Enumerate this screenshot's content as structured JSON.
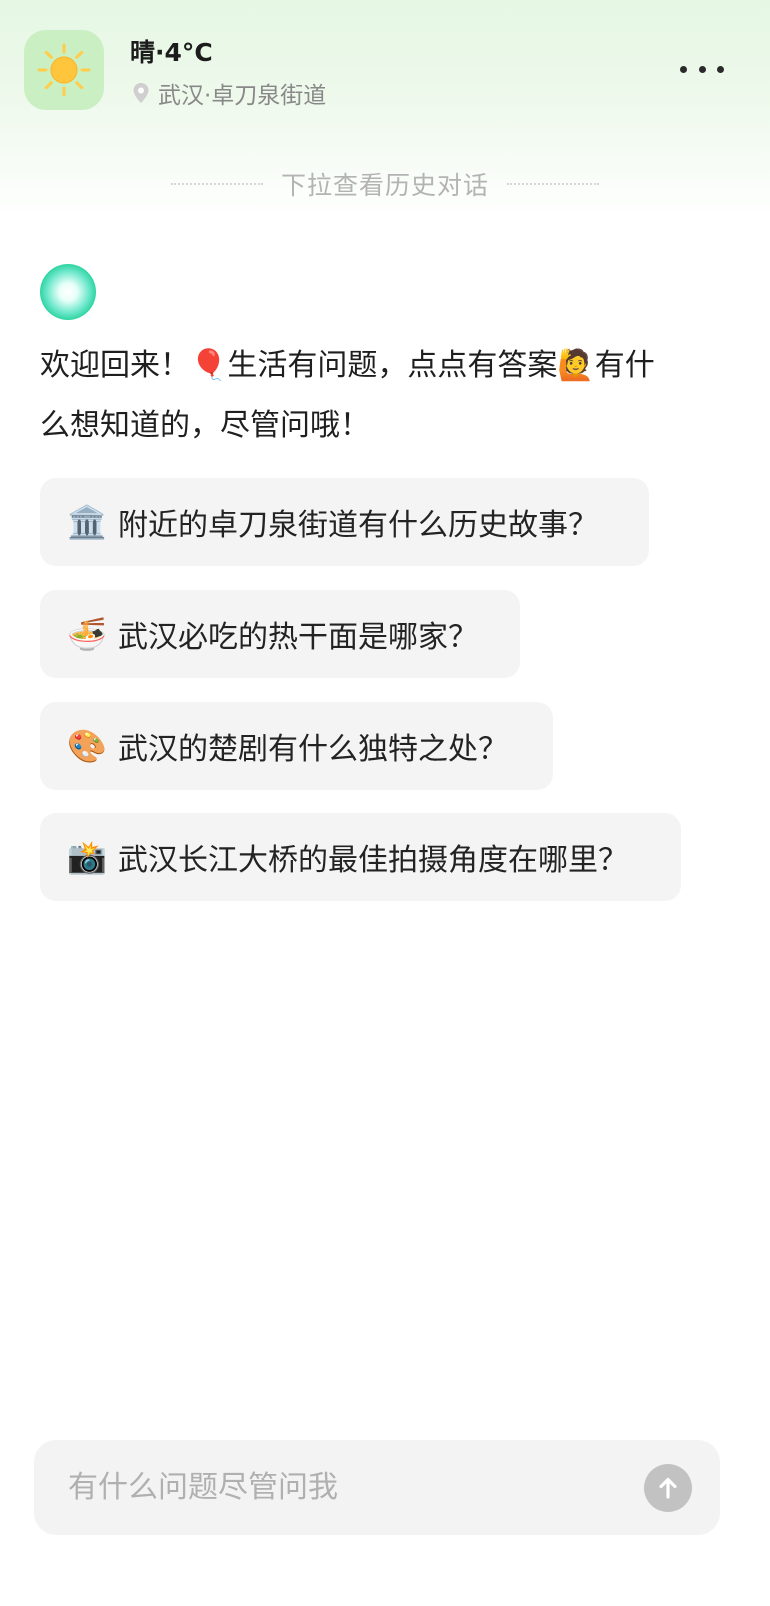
{
  "header": {
    "weather_title": "晴·4°C",
    "location": "武汉·卓刀泉街道",
    "weather_icon": "sun-icon",
    "more_icon": "more-dots-icon"
  },
  "history_hint": "下拉查看历史对话",
  "assistant": {
    "avatar_icon": "assistant-orb-icon",
    "welcome_line1": "欢迎回来！🎈生活有问题，点点有答案🙋有什",
    "welcome_line2": "么想知道的，尽管问哦！"
  },
  "suggestions": [
    {
      "icon": "🏛️",
      "icon_name": "museum-icon",
      "text": "附近的卓刀泉街道有什么历史故事？"
    },
    {
      "icon": "🍜",
      "icon_name": "noodles-icon",
      "text": "武汉必吃的热干面是哪家？"
    },
    {
      "icon": "🎨",
      "icon_name": "palette-icon",
      "text": "武汉的楚剧有什么独特之处？"
    },
    {
      "icon": "📸",
      "icon_name": "camera-icon",
      "text": "武汉长江大桥的最佳拍摄角度在哪里？"
    }
  ],
  "input": {
    "placeholder": "有什么问题尽管问我",
    "value": "",
    "send_icon": "send-arrow-icon"
  },
  "colors": {
    "header_gradient": "#e6f7e4",
    "weather_icon_bg": "#c9efc2",
    "sun": "#ffc53d",
    "chip_bg": "#f4f4f4",
    "send_button": "#c2c2c2",
    "avatar_green": "#2bd39f"
  }
}
